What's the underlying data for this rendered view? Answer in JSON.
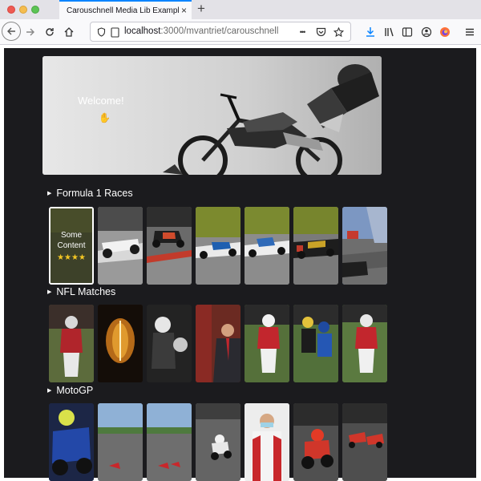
{
  "browser": {
    "tab_title": "Carouschnell Media Lib Example",
    "tab_close": "×",
    "new_tab": "+",
    "url_host": "localhost",
    "url_path": ":3000/mvantriet/carouschnell",
    "more_icon": "•••"
  },
  "hero": {
    "title": "Welcome!",
    "icon": "hand-icon"
  },
  "rows": [
    {
      "title": "Formula 1 Races"
    },
    {
      "title": "NFL Matches"
    },
    {
      "title": "MotoGP"
    }
  ],
  "focused_card": {
    "text": "Some Content",
    "rating": 4,
    "stars": "★★★★"
  },
  "colors": {
    "page_bg": "#1b1b1e",
    "accent": "#0a84ff",
    "star": "#f3c623"
  }
}
